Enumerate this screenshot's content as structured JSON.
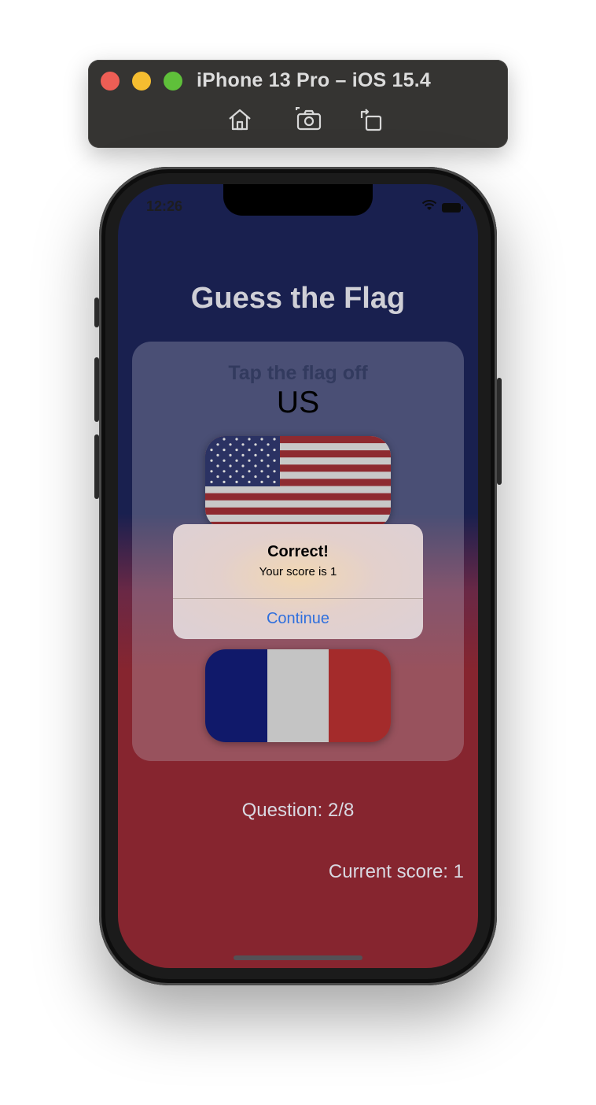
{
  "simulator": {
    "title": "iPhone 13 Pro – iOS 15.4",
    "toolbar_icons": [
      "home-icon",
      "screenshot-icon",
      "rotate-icon"
    ]
  },
  "status_bar": {
    "time": "12:26",
    "icons": [
      "wifi-icon",
      "battery-icon"
    ]
  },
  "app": {
    "title": "Guess the Flag",
    "prompt": "Tap the flag off",
    "country": "US",
    "flags": [
      "united-states-flag",
      "france-flag"
    ],
    "question_label": "Question: 2/8",
    "score_label": "Current score: 1"
  },
  "alert": {
    "title": "Correct!",
    "message": "Your score is 1",
    "button_label": "Continue",
    "button_color": "#2f6fdd"
  },
  "colors": {
    "background_top": "#19204f",
    "background_bottom": "#86252f"
  }
}
